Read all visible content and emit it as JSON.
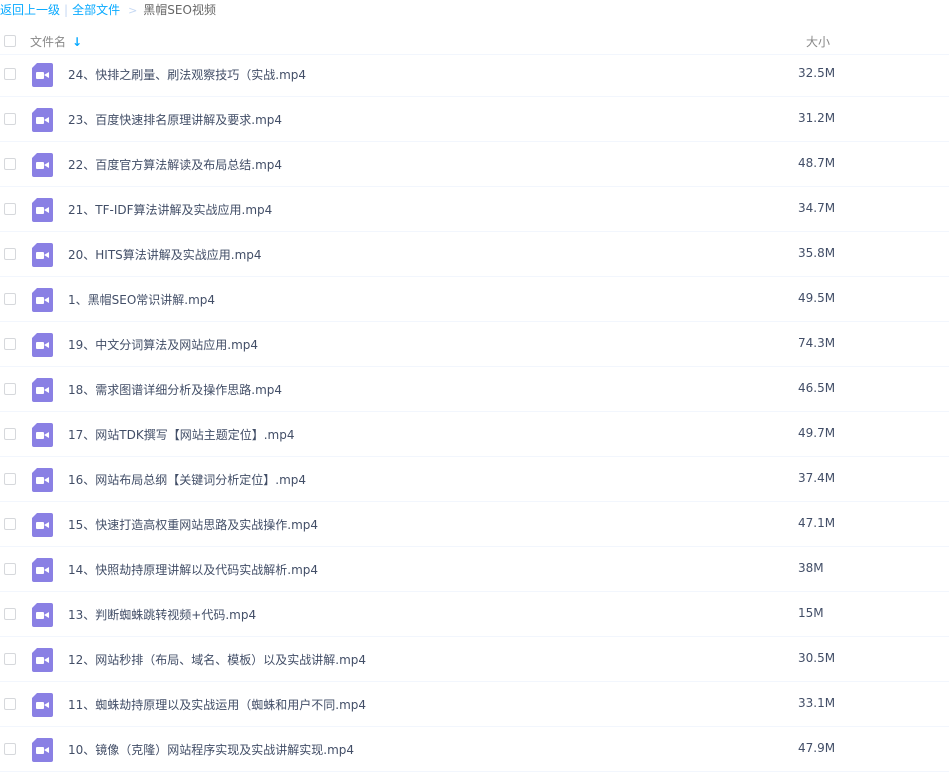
{
  "breadcrumb": {
    "back": "返回上一级",
    "separator": "|",
    "all_files": "全部文件",
    "arrow": ">",
    "current": "黑帽SEO视频"
  },
  "header": {
    "name_label": "文件名",
    "sort_icon": "sort-down-arrow",
    "size_label": "大小"
  },
  "colors": {
    "link": "#09aaff",
    "video_icon": "#8a80e4",
    "text": "#424e67"
  },
  "files": [
    {
      "name": "24、快排之刷量、刷法观察技巧（实战.mp4",
      "size": "32.5M",
      "icon": "video-file-icon"
    },
    {
      "name": "23、百度快速排名原理讲解及要求.mp4",
      "size": "31.2M",
      "icon": "video-file-icon"
    },
    {
      "name": "22、百度官方算法解读及布局总结.mp4",
      "size": "48.7M",
      "icon": "video-file-icon"
    },
    {
      "name": "21、TF-IDF算法讲解及实战应用.mp4",
      "size": "34.7M",
      "icon": "video-file-icon"
    },
    {
      "name": "20、HITS算法讲解及实战应用.mp4",
      "size": "35.8M",
      "icon": "video-file-icon"
    },
    {
      "name": "1、黑帽SEO常识讲解.mp4",
      "size": "49.5M",
      "icon": "video-file-icon"
    },
    {
      "name": "19、中文分词算法及网站应用.mp4",
      "size": "74.3M",
      "icon": "video-file-icon"
    },
    {
      "name": "18、需求图谱详细分析及操作思路.mp4",
      "size": "46.5M",
      "icon": "video-file-icon"
    },
    {
      "name": "17、网站TDK撰写【网站主题定位】.mp4",
      "size": "49.7M",
      "icon": "video-file-icon"
    },
    {
      "name": "16、网站布局总纲【关键词分析定位】.mp4",
      "size": "37.4M",
      "icon": "video-file-icon"
    },
    {
      "name": "15、快速打造高权重网站思路及实战操作.mp4",
      "size": "47.1M",
      "icon": "video-file-icon"
    },
    {
      "name": "14、快照劫持原理讲解以及代码实战解析.mp4",
      "size": "38M",
      "icon": "video-file-icon"
    },
    {
      "name": "13、判断蜘蛛跳转视频+代码.mp4",
      "size": "15M",
      "icon": "video-file-icon"
    },
    {
      "name": "12、网站秒排（布局、域名、模板）以及实战讲解.mp4",
      "size": "30.5M",
      "icon": "video-file-icon"
    },
    {
      "name": "11、蜘蛛劫持原理以及实战运用（蜘蛛和用户不同.mp4",
      "size": "33.1M",
      "icon": "video-file-icon"
    },
    {
      "name": "10、镜像（克隆）网站程序实现及实战讲解实现.mp4",
      "size": "47.9M",
      "icon": "video-file-icon"
    }
  ]
}
